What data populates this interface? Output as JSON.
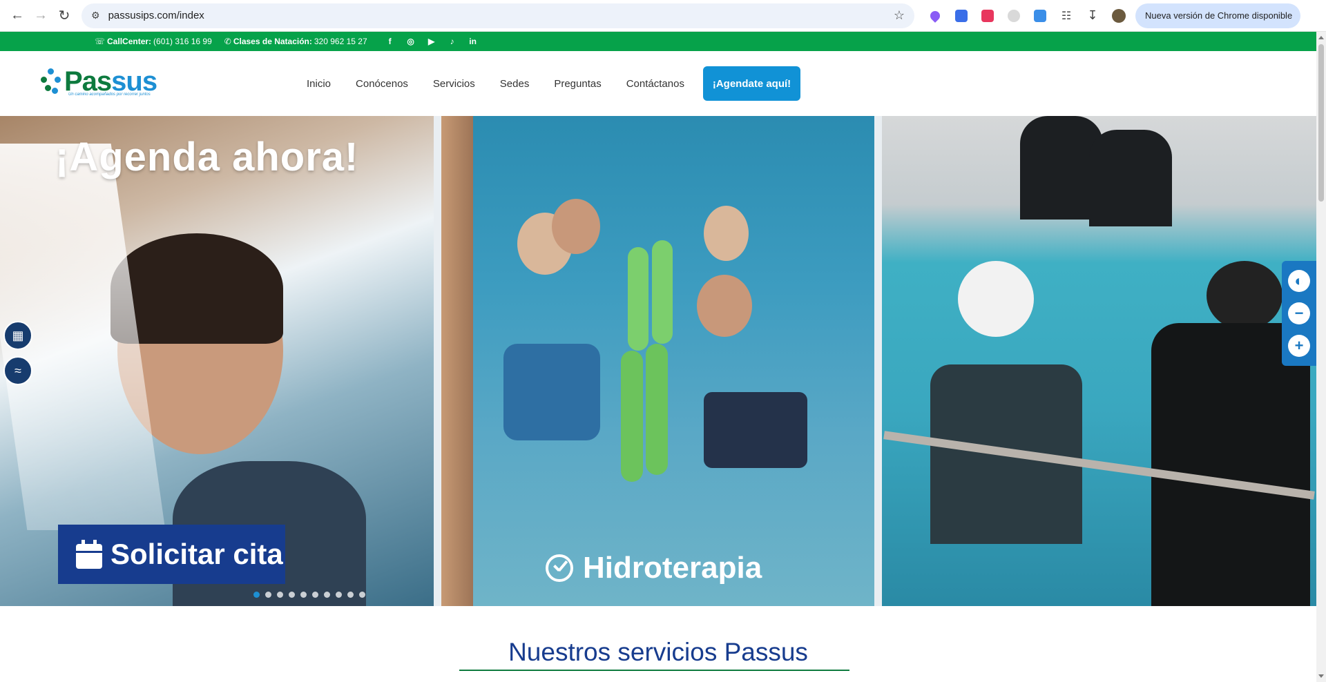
{
  "browser": {
    "url": "passusips.com/index",
    "update_label": "Nueva versión de Chrome disponible",
    "extension_colors": [
      "#8a5cf5",
      "#3a6ee8",
      "#e8365d",
      "#cccccc",
      "#3a8ee8"
    ]
  },
  "topbar": {
    "callcenter_label": "CallCenter:",
    "callcenter_number": "(601) 316 16 99",
    "swim_label": "Clases de Natación:",
    "swim_number": "320 962 15 27",
    "social": [
      "f",
      "◎",
      "▶",
      "♪",
      "in"
    ],
    "color": "#06a24a"
  },
  "header": {
    "logo_text_1": "Pas",
    "logo_text_2": "sus",
    "logo_tagline": "Un camino acompañados por recorrer juntos",
    "menu": [
      "Inicio",
      "Conócenos",
      "Servicios",
      "Sedes",
      "Preguntas",
      "Contáctanos"
    ],
    "cta": "¡Agendate aquí!"
  },
  "hero": {
    "headline": "¡Agenda ahora!",
    "solicitar": "Solicitar cita",
    "hidroterapia": "Hidroterapia",
    "slide_count": 10,
    "active_slide": 0
  },
  "accessibility": {
    "buttons": [
      "◐",
      "−",
      "+"
    ]
  },
  "section": {
    "title": "Nuestros servicios Passus"
  }
}
